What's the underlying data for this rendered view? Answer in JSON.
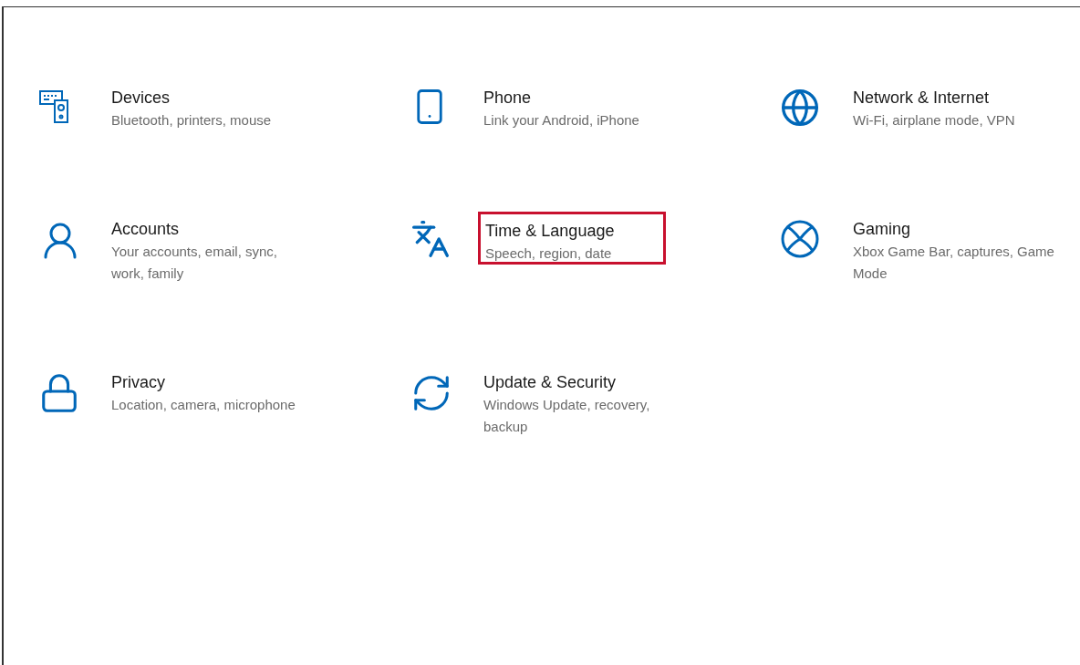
{
  "categories": [
    {
      "kind": "devices",
      "title": "Devices",
      "description": "Bluetooth, printers, mouse",
      "highlighted": false
    },
    {
      "kind": "phone",
      "title": "Phone",
      "description": "Link your Android, iPhone",
      "highlighted": false
    },
    {
      "kind": "network",
      "title": "Network & Internet",
      "description": "Wi-Fi, airplane mode, VPN",
      "highlighted": false
    },
    {
      "kind": "accounts",
      "title": "Accounts",
      "description": "Your accounts, email, sync, work, family",
      "highlighted": false
    },
    {
      "kind": "time",
      "title": "Time & Language",
      "description": "Speech, region, date",
      "highlighted": true
    },
    {
      "kind": "gaming",
      "title": "Gaming",
      "description": "Xbox Game Bar, captures, Game Mode",
      "highlighted": false
    },
    {
      "kind": "privacy",
      "title": "Privacy",
      "description": "Location, camera, microphone",
      "highlighted": false
    },
    {
      "kind": "update",
      "title": "Update & Security",
      "description": "Windows Update, recovery, backup",
      "highlighted": false
    }
  ]
}
